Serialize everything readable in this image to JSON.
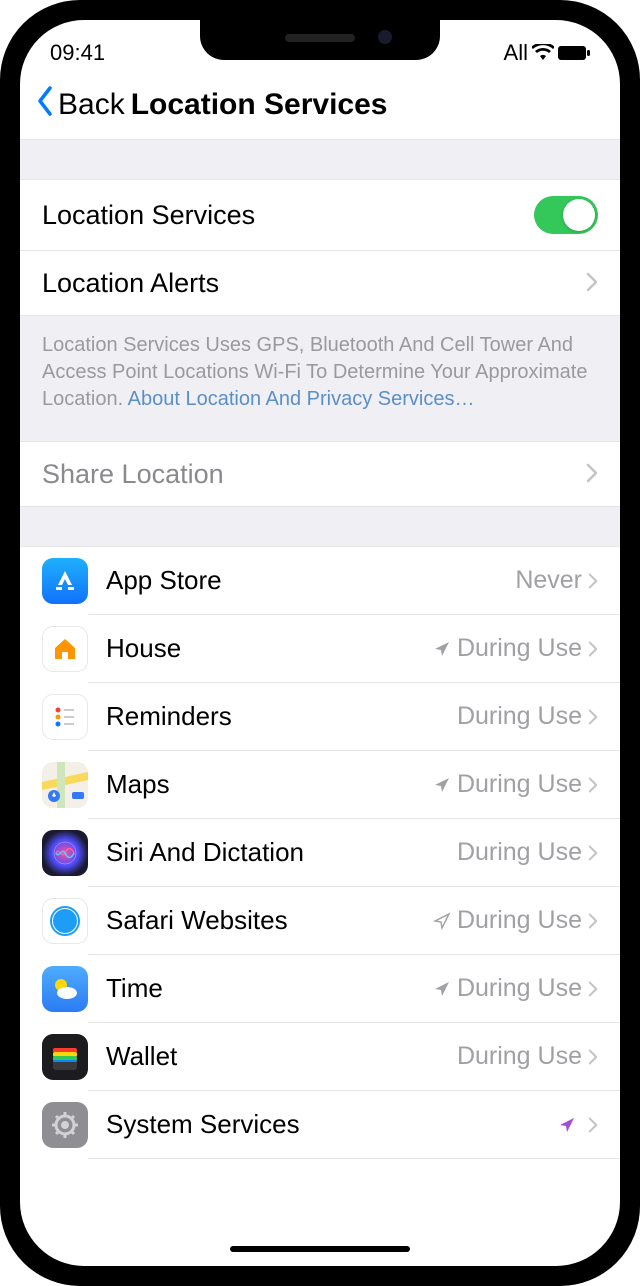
{
  "status": {
    "time": "09:41",
    "carrier": "All"
  },
  "nav": {
    "back": "Back",
    "title": "Location Services"
  },
  "main": {
    "location_services_label": "Location Services",
    "location_alerts_label": "Location Alerts",
    "footer_line1": "Location Services Uses GPS, Bluetooth And Cell Tower And Access Point Locations Wi-Fi To Determine Your Approximate Location.",
    "footer_link": "About Location And Privacy Services…",
    "share_location_label": "Share Location"
  },
  "apps": [
    {
      "name": "App Store",
      "status": "Never",
      "arrow": "none",
      "icon": "appstore"
    },
    {
      "name": "House",
      "status": "During Use",
      "arrow": "gray",
      "icon": "home"
    },
    {
      "name": "Reminders",
      "status": "During Use",
      "arrow": "none",
      "icon": "reminders"
    },
    {
      "name": "Maps",
      "status": "During Use",
      "arrow": "gray",
      "icon": "maps"
    },
    {
      "name": "Siri And Dictation",
      "status": "During Use",
      "arrow": "none",
      "icon": "siri"
    },
    {
      "name": "Safari Websites",
      "status": "During Use",
      "arrow": "outline",
      "icon": "safari"
    },
    {
      "name": "Time",
      "status": "During Use",
      "arrow": "gray",
      "icon": "weather"
    },
    {
      "name": "Wallet",
      "status": "During Use",
      "arrow": "none",
      "icon": "wallet"
    },
    {
      "name": "System Services",
      "status": "",
      "arrow": "purple",
      "icon": "system"
    }
  ]
}
